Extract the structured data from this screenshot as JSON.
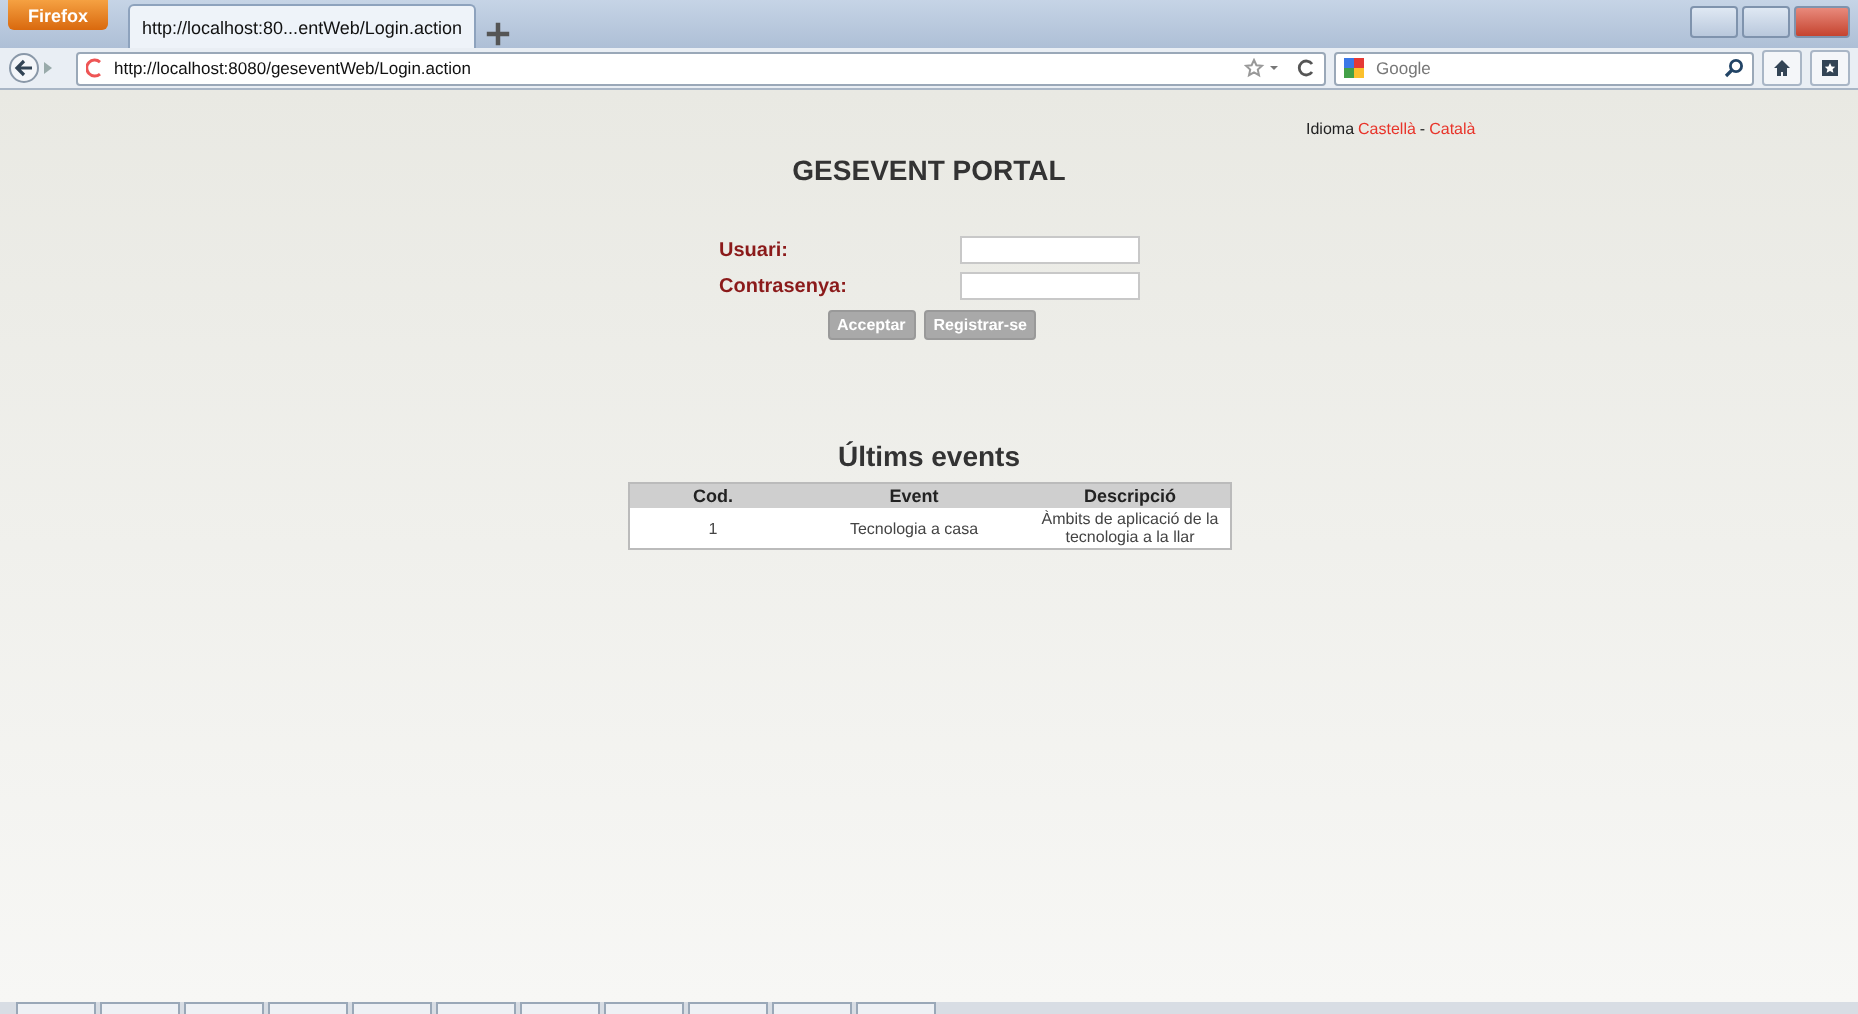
{
  "browser": {
    "menu_button": "Firefox",
    "tabs": [
      {
        "label": "http://localhost:80...entWeb/Login.action",
        "selected": true
      }
    ],
    "address": "http://localhost:8080/geseventWeb/Login.action",
    "search_placeholder": "Google"
  },
  "language": {
    "label": "Idioma",
    "options": [
      {
        "label": "Castellà"
      },
      {
        "label": "Català"
      }
    ],
    "separator": "-"
  },
  "title": "GESEVENT PORTAL",
  "form": {
    "fields": [
      {
        "label": "Usuari:"
      },
      {
        "label": "Contrasenya:"
      }
    ],
    "buttons": [
      "Acceptar",
      "Registrar-se"
    ]
  },
  "events": {
    "title": "Últims events",
    "columns": [
      "Cod.",
      "Event",
      "Descripció"
    ],
    "rows": [
      [
        "1",
        "Tecnologia a casa",
        "Àmbits de aplicació de la tecnologia a la llar"
      ]
    ]
  }
}
